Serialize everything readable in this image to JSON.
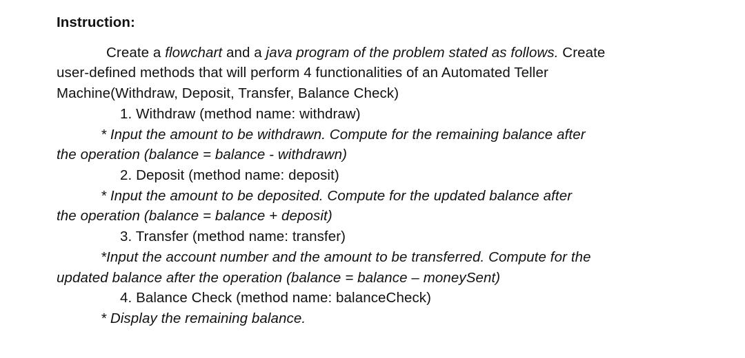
{
  "heading": "Instruction:",
  "intro_line1_a": "Create a ",
  "intro_line1_b": "flowchart",
  "intro_line1_c": " and a ",
  "intro_line1_d": "java program of the problem stated as follows.",
  "intro_line1_e": " Create",
  "intro_line2": "user-defined methods that will perform 4 functionalities of an Automated Teller",
  "intro_line3": "Machine(Withdraw, Deposit, Transfer, Balance Check)",
  "item1_title": "1. Withdraw (method name: withdraw)",
  "item1_note_a": "* Input the amount to be withdrawn. Compute for the remaining balance after",
  "item1_note_b": "the operation (balance = balance - withdrawn)",
  "item2_title": "2. Deposit (method name: deposit)",
  "item2_note_a": "* Input the amount to be deposited. Compute for the updated balance after",
  "item2_note_b": "the operation (balance = balance + deposit)",
  "item3_title": "3. Transfer (method name: transfer)",
  "item3_note_a": "*Input the account number and the amount to be transferred. Compute for the",
  "item3_note_b": "updated balance after the operation (balance = balance – moneySent)",
  "item4_title": "4. Balance Check (method name: balanceCheck)",
  "item4_note": "* Display the remaining balance."
}
